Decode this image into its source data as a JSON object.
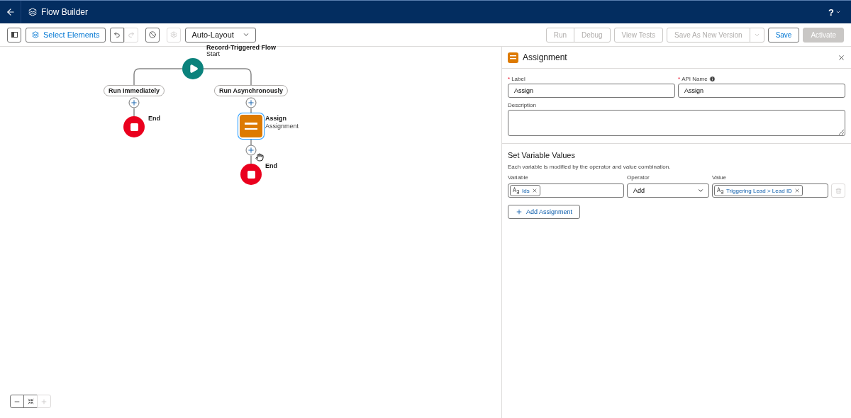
{
  "header": {
    "title": "Flow Builder",
    "help": "?"
  },
  "toolbar": {
    "select_label": "Select Elements",
    "redo_disabled": true,
    "settings_disabled": true,
    "layout": "Auto-Layout",
    "actions": [
      {
        "label": "Run",
        "disabled": true,
        "joined": true,
        "kind": "neutral"
      },
      {
        "label": "Debug",
        "disabled": true,
        "joined": false,
        "kind": "neutral"
      },
      {
        "label": "View Tests",
        "disabled": true,
        "joined": false,
        "kind": "neutral"
      },
      {
        "label": "Save As New Version",
        "disabled": true,
        "joined": false,
        "kind": "split"
      },
      {
        "label": "Save",
        "disabled": false,
        "joined": false,
        "kind": "neutral"
      },
      {
        "label": "Activate",
        "disabled": true,
        "joined": false,
        "kind": "brand"
      }
    ]
  },
  "canvas": {
    "start": {
      "title": "Record-Triggered Flow",
      "subtitle": "Start"
    },
    "branches": [
      {
        "label": "Run Immediately",
        "elements": [
          {
            "kind": "end",
            "label": "End"
          }
        ]
      },
      {
        "label": "Run Asynchronously",
        "elements": [
          {
            "kind": "assignment",
            "label": "Assign",
            "type": "Assignment",
            "selected": true
          },
          {
            "kind": "end",
            "label": "End"
          }
        ]
      }
    ],
    "zoom_in_disabled": true
  },
  "panel": {
    "title": "Assignment",
    "label": {
      "label": "Label",
      "value": "Assign",
      "required_mark": "*"
    },
    "api_name": {
      "label": "API Name",
      "value": "Assign",
      "required_mark": "*"
    },
    "description": {
      "label": "Description"
    },
    "section_title": "Set Variable Values",
    "help": "Each variable is modified by the operator and value combination.",
    "columns": [
      "Variable",
      "Operator",
      "Value"
    ],
    "rows": [
      {
        "variable": "Ids",
        "operator": "Add",
        "value": "Triggering Lead > Lead ID"
      }
    ],
    "add_label": "Add Assignment"
  }
}
